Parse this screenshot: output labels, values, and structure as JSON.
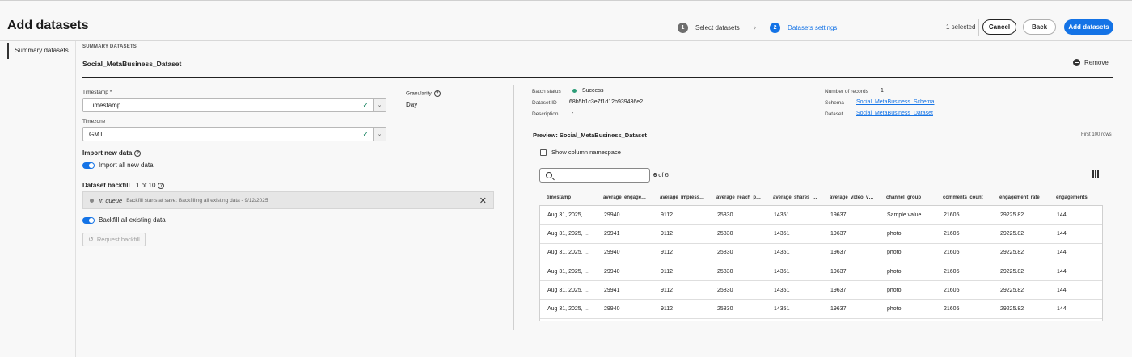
{
  "header": {
    "title": "Add datasets",
    "steps": [
      {
        "num": "1",
        "label": "Select datasets"
      },
      {
        "num": "2",
        "label": "Datasets settings"
      }
    ],
    "step_separator": "›",
    "selected_count": "1 selected",
    "cancel_label": "Cancel",
    "back_label": "Back",
    "add_label": "Add datasets"
  },
  "sidebar": {
    "items": [
      {
        "label": "Summary datasets"
      }
    ]
  },
  "summary": {
    "caption": "SUMMARY DATASETS",
    "dataset_name": "Social_MetaBusiness_Dataset",
    "remove_label": "Remove"
  },
  "settings": {
    "timestamp_label": "Timestamp",
    "timestamp_required": "*",
    "timestamp_value": "Timestamp",
    "granularity_label": "Granularity",
    "granularity_value": "Day",
    "timezone_label": "Timezone",
    "timezone_value": "GMT",
    "import_heading": "Import new data",
    "import_toggle_label": "Import all new data",
    "backfill_heading": "Dataset backfill",
    "backfill_count": "1 of 10",
    "queue_status": "In queue",
    "queue_message": "Backfill starts at save: Backfilling all existing data - 9/12/2025",
    "backfill_toggle_label": "Backfill all existing data",
    "request_backfill_label": "Request backfill"
  },
  "info": {
    "batch_status_label": "Batch status",
    "batch_status_value": "Success",
    "dataset_id_label": "Dataset ID",
    "dataset_id_value": "68b5b1c3e7f1d12b939436e2",
    "description_label": "Description",
    "description_value": "-",
    "records_label": "Number of records",
    "records_value": "1",
    "schema_label": "Schema",
    "schema_value": "Social_MetaBusiness_Schema",
    "dataset_label": "Dataset",
    "dataset_value": "Social_MetaBusiness_Dataset"
  },
  "preview": {
    "title": "Preview: Social_MetaBusiness_Dataset",
    "first_rows": "First 100 rows",
    "namespace_label": "Show column namespace",
    "search_placeholder": "",
    "result_count_bold": "6",
    "result_count_rest": "of 6",
    "columns": [
      "timestamp",
      "average_engage…",
      "average_impress…",
      "average_reach_p…",
      "average_shares_…",
      "average_video_v…",
      "channel_group",
      "comments_count",
      "engagement_rate",
      "engagements"
    ],
    "rows": [
      [
        "Aug 31, 2025, …",
        "29940",
        "9112",
        "25830",
        "14351",
        "19637",
        "Sample value",
        "21605",
        "29225.82",
        "144"
      ],
      [
        "Aug 31, 2025, …",
        "29941",
        "9112",
        "25830",
        "14351",
        "19637",
        "photo",
        "21605",
        "29225.82",
        "144"
      ],
      [
        "Aug 31, 2025, …",
        "29940",
        "9112",
        "25830",
        "14351",
        "19637",
        "photo",
        "21605",
        "29225.82",
        "144"
      ],
      [
        "Aug 31, 2025, …",
        "29940",
        "9112",
        "25830",
        "14351",
        "19637",
        "photo",
        "21605",
        "29225.82",
        "144"
      ],
      [
        "Aug 31, 2025, …",
        "29941",
        "9112",
        "25830",
        "14351",
        "19637",
        "photo",
        "21605",
        "29225.82",
        "144"
      ],
      [
        "Aug 31, 2025, …",
        "29940",
        "9112",
        "25830",
        "14351",
        "19637",
        "photo",
        "21605",
        "29225.82",
        "144"
      ]
    ]
  },
  "colors": {
    "accent": "#1473e6",
    "success": "#2d9d78"
  }
}
